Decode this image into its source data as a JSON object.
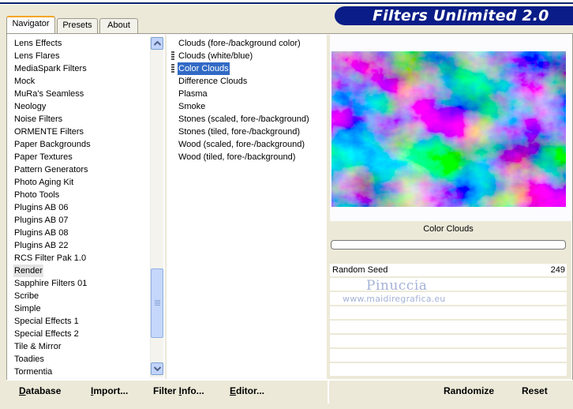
{
  "app": {
    "title": "Filters Unlimited 2.0"
  },
  "tabs": [
    {
      "label": "Navigator",
      "active": true
    },
    {
      "label": "Presets",
      "active": false
    },
    {
      "label": "About",
      "active": false
    }
  ],
  "categories": {
    "items": [
      "Lens Effects",
      "Lens Flares",
      "MediaSpark Filters",
      "Mock",
      "MuRa's Seamless",
      "Neology",
      "Noise Filters",
      "ORMENTE Filters",
      "Paper Backgrounds",
      "Paper Textures",
      "Pattern Generators",
      "Photo Aging Kit",
      "Photo Tools",
      "Plugins AB 06",
      "Plugins AB 07",
      "Plugins AB 08",
      "Plugins AB 22",
      "RCS Filter Pak 1.0",
      "Render",
      "Sapphire Filters 01",
      "Scribe",
      "Simple",
      "Special Effects 1",
      "Special Effects 2",
      "Tile & Mirror",
      "Toadies",
      "Tormentia"
    ],
    "selected": "Render"
  },
  "filters": {
    "items": [
      "Clouds (fore-/background color)",
      "Clouds (white/blue)",
      "Color Clouds",
      "Difference Clouds",
      "Plasma",
      "Smoke",
      "Stones (scaled, fore-/background)",
      "Stones (tiled, fore-/background)",
      "Wood (scaled, fore-/background)",
      "Wood (tiled, fore-/background)"
    ],
    "selected": "Color Clouds"
  },
  "preview": {
    "filter_name": "Color Clouds"
  },
  "parameters": [
    {
      "label": "Random Seed",
      "value": "249"
    }
  ],
  "watermark": {
    "name": "Pinuccia",
    "url": "www.maidiregrafica.eu"
  },
  "buttons": {
    "database": {
      "mnemonic": "D",
      "rest": "atabase"
    },
    "import": {
      "mnemonic": "I",
      "rest": "mport..."
    },
    "filter_info": {
      "pre": "Filter ",
      "mnemonic": "I",
      "rest": "nfo..."
    },
    "editor": {
      "mnemonic": "E",
      "rest": "ditor..."
    },
    "randomize": "Randomize",
    "reset": "Reset"
  },
  "colors": {
    "banner": "#0a1c87",
    "selection": "#316ac5",
    "tab_accent": "#f5a526",
    "face": "#ece9d8"
  },
  "icons": {
    "scroll_up": "chevron-up-icon",
    "scroll_down": "chevron-down-icon"
  }
}
